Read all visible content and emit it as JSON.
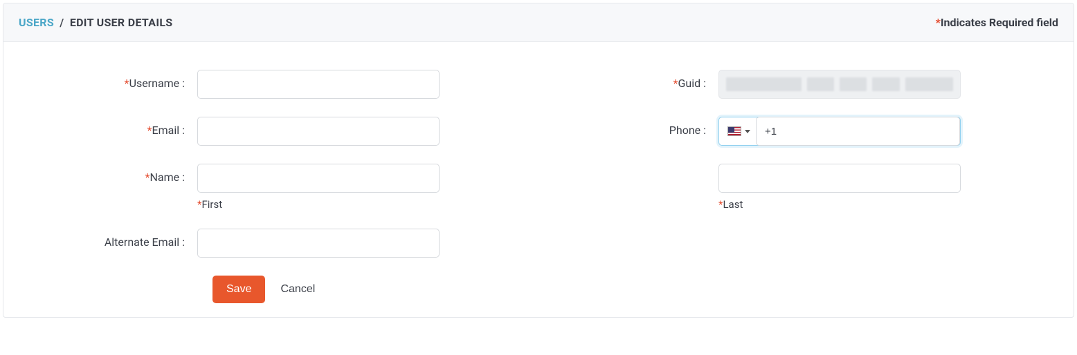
{
  "breadcrumb": {
    "parent": "USERS",
    "separator": "/",
    "current": "EDIT USER DETAILS"
  },
  "required_note": {
    "asterisk": "*",
    "text": "Indicates Required field"
  },
  "labels": {
    "username": "Username :",
    "email": "Email :",
    "name": "Name :",
    "alt_email": "Alternate Email :",
    "guid": "Guid :",
    "phone": "Phone :"
  },
  "sublabels": {
    "first": "First",
    "last": "Last"
  },
  "asterisk": "*",
  "fields": {
    "username": "",
    "email": "",
    "first_name": "",
    "last_name": "",
    "alt_email": "",
    "guid_display": "",
    "phone_prefix": "+1",
    "phone_value": "+1"
  },
  "buttons": {
    "save": "Save",
    "cancel": "Cancel"
  }
}
